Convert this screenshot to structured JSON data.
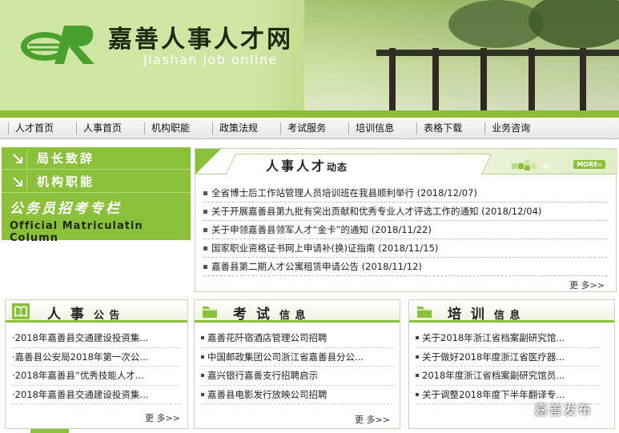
{
  "header": {
    "title": "嘉善人事人才网",
    "subtitle": "Jiashan job online"
  },
  "nav": {
    "items": [
      "人才首页",
      "人事首页",
      "机构职能",
      "政策法规",
      "考试服务",
      "培训信息",
      "表格下载",
      "业务咨询"
    ]
  },
  "leftmenu": {
    "items": [
      "局长致辞",
      "机构职能"
    ],
    "title": "公务员招考专栏",
    "subtitle": "Official Matriculatin Column"
  },
  "news": {
    "title_main": "人事人才",
    "title_small": "动态",
    "more_badge": "MORE»",
    "items": [
      "全省博士后工作站管理人员培训班在我县顺利举行 (2018/12/07)",
      "关于开展嘉善县第九批有突出贡献和优秀专业人才评选工作的通知 (2018/12/04)",
      "关于申领嘉善县领军人才“金卡”的通知 (2018/11/22)",
      "国家职业资格证书网上申请补(换)证指南 (2018/11/15)",
      "嘉善县第二期人才公寓租赁申请公告 (2018/11/12)"
    ],
    "more": "更 多>>"
  },
  "panels": {
    "renshi": {
      "title_main": "人 事",
      "title_small": "公 告",
      "items": [
        "·2018年嘉善县交通建设投资集...",
        "·嘉善县公安局2018年第一次公...",
        "·2018年嘉善县“优秀技能人才...",
        "·2018年嘉善县交通建设投资集..."
      ],
      "more": "更 多>>"
    },
    "kaoshi": {
      "title_main": "考 试",
      "title_small": "信 息",
      "items": [
        "嘉善花阡宿酒店管理公司招聘",
        "中国邮政集团公司浙江省嘉善县分公...",
        "嘉兴银行嘉善支行招聘启示",
        "嘉善县电影发行放映公司招聘"
      ],
      "more": "更 多>>"
    },
    "peixun": {
      "title_main": "培 训",
      "title_small": "信 息",
      "items": [
        "关于2018年浙江省档案副研究馆...",
        "关于做好2018年度浙江省医疗器...",
        "2018年度浙江省档案副研究馆员...",
        "关于调整2018年度下半年翻译专..."
      ],
      "more": "更 多>>"
    }
  },
  "watermark": "嘉善发布",
  "colors": {
    "accent_green": "#8bc13a",
    "header_green": "#cfe5a3"
  }
}
